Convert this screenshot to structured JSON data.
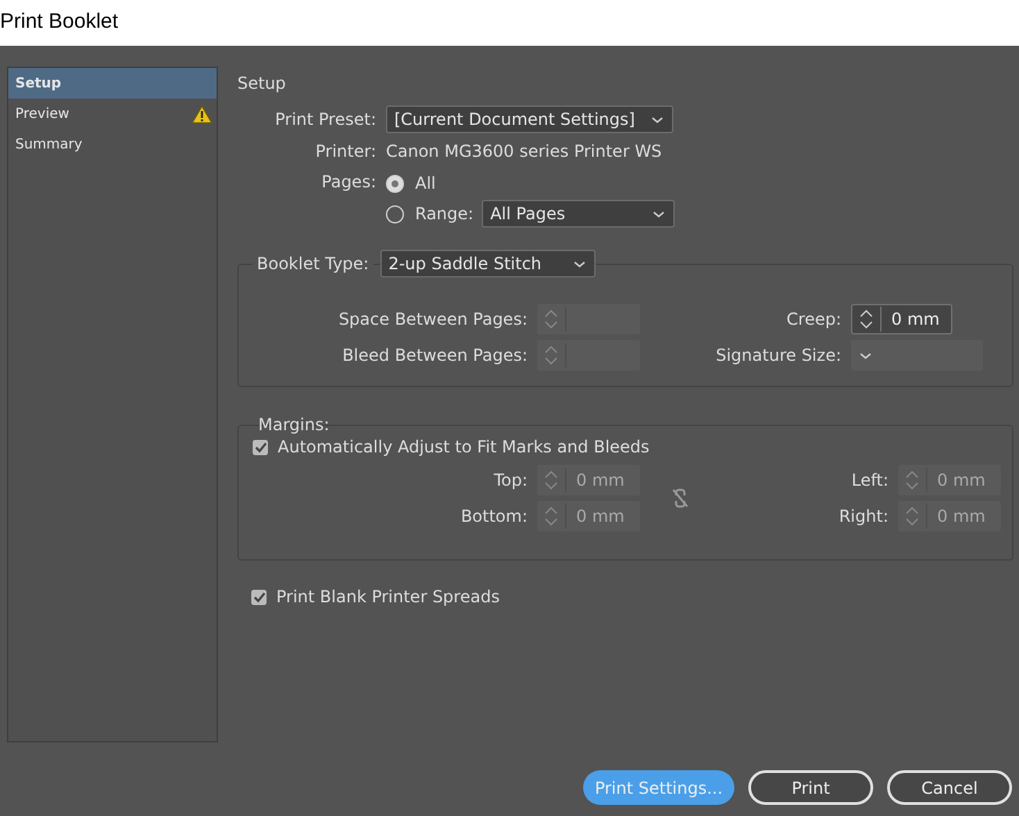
{
  "window": {
    "title": "Print Booklet"
  },
  "sidebar": {
    "items": [
      {
        "label": "Setup",
        "selected": true,
        "warning": false
      },
      {
        "label": "Preview",
        "selected": false,
        "warning": true
      },
      {
        "label": "Summary",
        "selected": false,
        "warning": false
      }
    ]
  },
  "section_title": "Setup",
  "print_preset": {
    "label": "Print Preset:",
    "value": "[Current Document Settings]"
  },
  "printer": {
    "label": "Printer:",
    "value": "Canon MG3600 series Printer WS"
  },
  "pages": {
    "label": "Pages:",
    "options": [
      {
        "label": "All",
        "selected": true
      },
      {
        "label": "Range:",
        "selected": false
      }
    ],
    "range_value": "All Pages"
  },
  "booklet": {
    "label": "Booklet Type:",
    "value": "2-up Saddle Stitch",
    "fields": [
      {
        "label": "Space Between Pages:",
        "kind": "spinner",
        "disabled": true
      },
      {
        "label": "Creep:",
        "kind": "spinner",
        "disabled": false,
        "value": "0 mm"
      },
      {
        "label": "Bleed Between Pages:",
        "kind": "spinner",
        "disabled": true
      },
      {
        "label": "Signature Size:",
        "kind": "dropdown",
        "disabled": true
      }
    ]
  },
  "margins": {
    "label": "Margins:",
    "auto_adjust": {
      "label": "Automatically Adjust to Fit Marks and Bleeds",
      "checked": true
    },
    "linked": false,
    "fields": [
      {
        "label": "Top:",
        "value": "0 mm",
        "disabled": true
      },
      {
        "label": "Left:",
        "value": "0 mm",
        "disabled": true
      },
      {
        "label": "Bottom:",
        "value": "0 mm",
        "disabled": true
      },
      {
        "label": "Right:",
        "value": "0 mm",
        "disabled": true
      }
    ]
  },
  "print_blank": {
    "label": "Print Blank Printer Spreads",
    "checked": true
  },
  "buttons": [
    {
      "label": "Print Settings...",
      "kind": "primary"
    },
    {
      "label": "Print",
      "kind": "outline"
    },
    {
      "label": "Cancel",
      "kind": "outline"
    }
  ]
}
